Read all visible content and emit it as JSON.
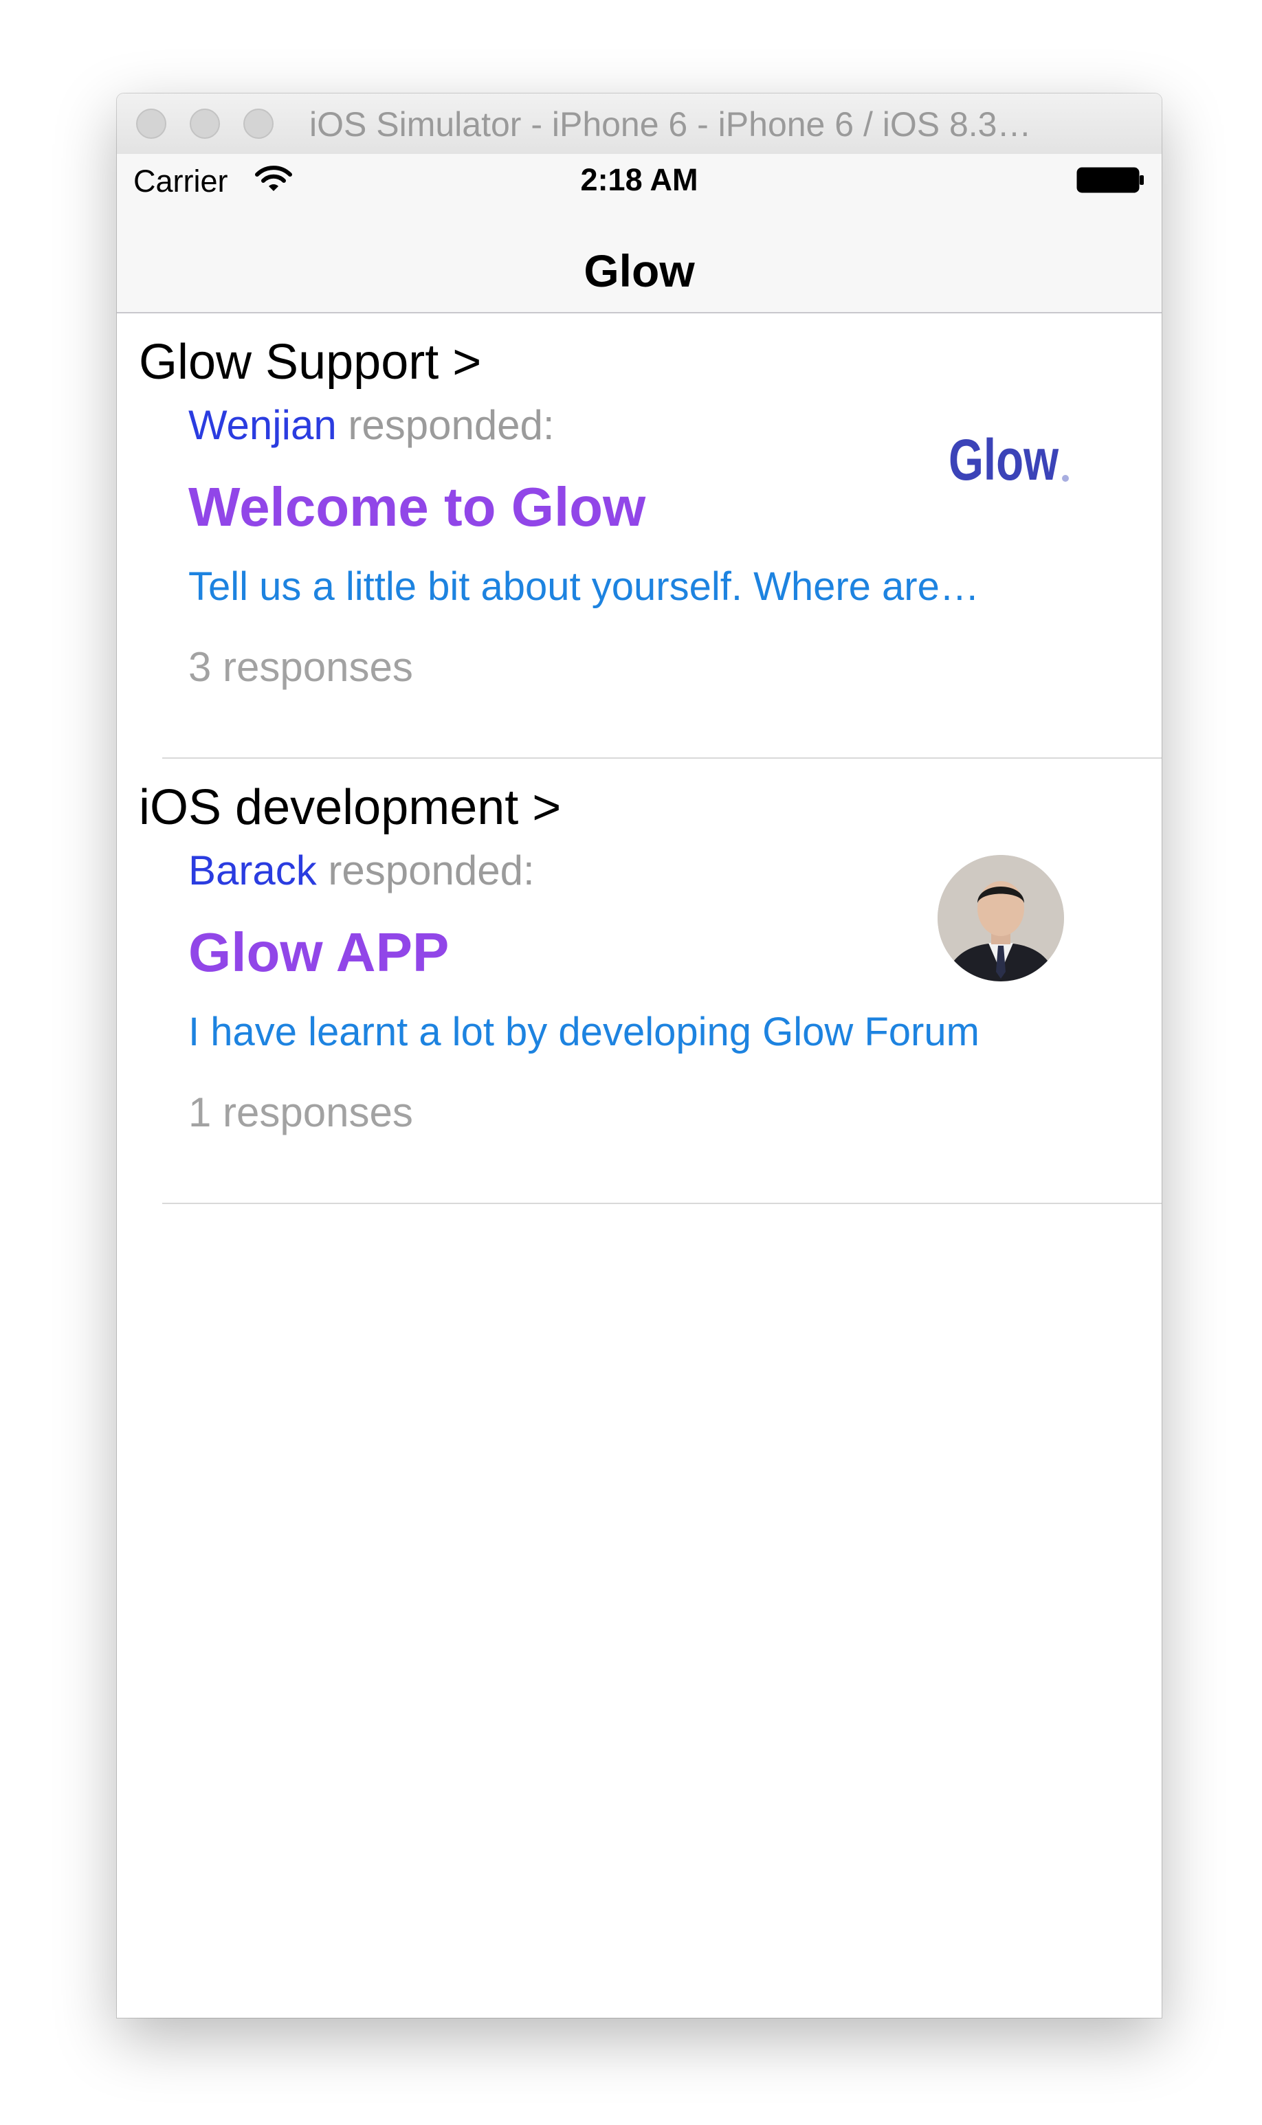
{
  "window": {
    "title": "iOS Simulator - iPhone 6 - iPhone 6 / iOS 8.3…"
  },
  "status_bar": {
    "carrier": "Carrier",
    "time": "2:18 AM"
  },
  "nav": {
    "title": "Glow"
  },
  "topics": [
    {
      "group": "Glow Support >",
      "responder": "Wenjian",
      "responded_label": " responded:",
      "title": "Welcome to Glow",
      "snippet": "Tell us a little bit about yourself. Where are…",
      "count": "3 responses",
      "thumbnail": "glow-logo",
      "logo_text": "Glow"
    },
    {
      "group": "iOS development >",
      "responder": "Barack",
      "responded_label": " responded:",
      "title": "Glow APP",
      "snippet": "I have learnt a lot by developing Glow Forum",
      "count": "1 responses",
      "thumbnail": "avatar"
    }
  ],
  "colors": {
    "responder": "#2a3ce0",
    "title": "#9146e8",
    "snippet": "#1d83e0",
    "muted": "#9b9b9b"
  }
}
